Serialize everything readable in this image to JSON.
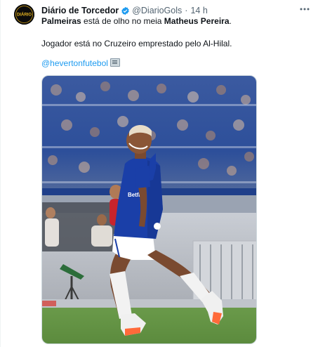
{
  "tweet": {
    "author": {
      "display_name": "Diário de Torcedor",
      "handle": "@DiarioGols",
      "verified": true,
      "avatar_text": "DIÁRIO"
    },
    "separator": "·",
    "time": "14 h",
    "more_icon": "more-horizontal-icon",
    "text": {
      "line1_part1": "Palmeiras",
      "line1_part2": " está de olho no meia ",
      "line1_part3": "Matheus Pereira",
      "line1_part4": ".",
      "line2": "Jogador está no Cruzeiro emprestado pelo Al-Hilal.",
      "mention": "@hevertonfutebol",
      "emoji": "newspaper-emoji"
    },
    "media": {
      "kind": "photo",
      "jersey_sponsor": "Betfair"
    }
  },
  "colors": {
    "link": "#1d9bf0",
    "verified": "#1d9bf0",
    "secondary_text": "#536471",
    "primary_text": "#0f1419",
    "jersey_blue": "#1a3fa8"
  }
}
